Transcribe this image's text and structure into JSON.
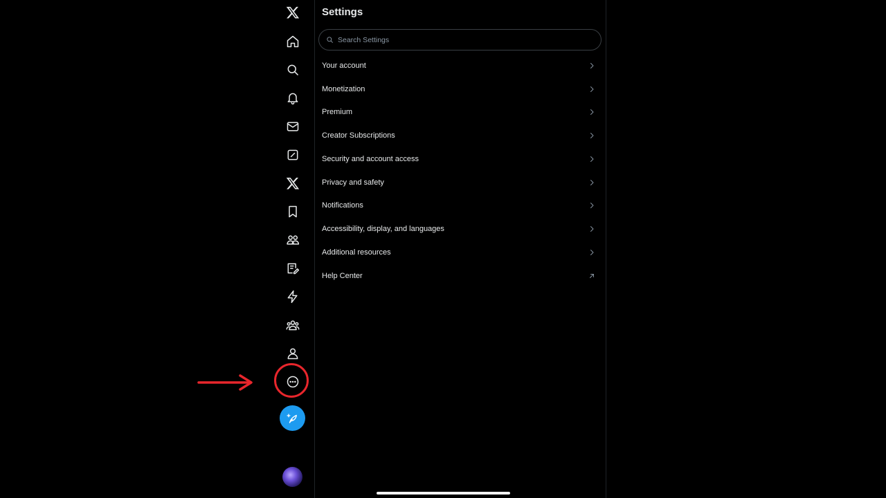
{
  "settings": {
    "title": "Settings",
    "search_placeholder": "Search Settings",
    "items": [
      {
        "label": "Your account",
        "icon": "chevron-right-icon"
      },
      {
        "label": "Monetization",
        "icon": "chevron-right-icon"
      },
      {
        "label": "Premium",
        "icon": "chevron-right-icon"
      },
      {
        "label": "Creator Subscriptions",
        "icon": "chevron-right-icon"
      },
      {
        "label": "Security and account access",
        "icon": "chevron-right-icon"
      },
      {
        "label": "Privacy and safety",
        "icon": "chevron-right-icon"
      },
      {
        "label": "Notifications",
        "icon": "chevron-right-icon"
      },
      {
        "label": "Accessibility, display, and languages",
        "icon": "chevron-right-icon"
      },
      {
        "label": "Additional resources",
        "icon": "chevron-right-icon"
      },
      {
        "label": "Help Center",
        "icon": "external-link-icon"
      }
    ]
  },
  "rail": {
    "icons": [
      "x-logo-icon",
      "home-icon",
      "search-icon",
      "bell-icon",
      "mail-icon",
      "grok-icon",
      "x-premium-icon",
      "bookmark-icon",
      "communities-icon",
      "articles-icon",
      "lightning-icon",
      "people-icon",
      "profile-icon",
      "more-icon"
    ],
    "compose_icon": "compose-icon"
  },
  "colors": {
    "background": "#000000",
    "text": "#e7e9ea",
    "secondary": "#8b98a5",
    "accent": "#1d9bf0",
    "annotation": "#e8262c"
  }
}
